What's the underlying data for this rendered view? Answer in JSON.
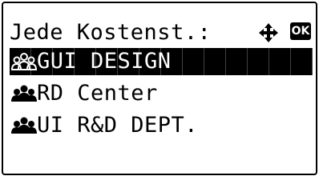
{
  "header": {
    "title": "Jede Kostenst.:",
    "nav_icon": "four-way-arrow-icon",
    "ok_label": "OK"
  },
  "menu": {
    "items": [
      {
        "label": "GUI DESIGN",
        "icon": "group-icon",
        "selected": true
      },
      {
        "label": "RD Center",
        "icon": "group-icon",
        "selected": false
      },
      {
        "label": "UI R&D DEPT.",
        "icon": "group-icon",
        "selected": false
      }
    ]
  },
  "colors": {
    "foreground": "#000000",
    "background": "#ffffff"
  }
}
